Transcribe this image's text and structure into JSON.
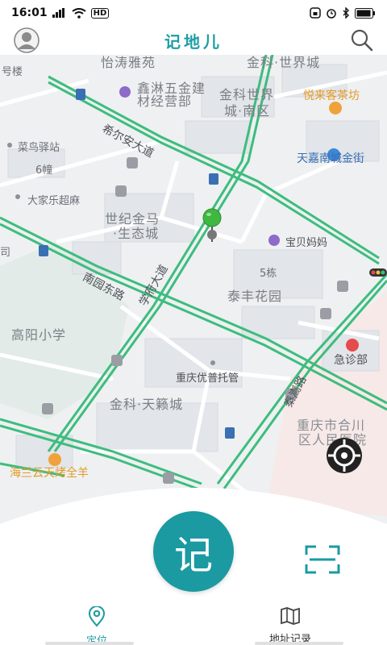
{
  "status_bar": {
    "time": "16:01",
    "network": "HD"
  },
  "header": {
    "title": "记地儿"
  },
  "map": {
    "labels": {
      "l1": "怡涛雅苑",
      "l2": "金科·世界城",
      "l3": "号楼",
      "l4": "鑫淋五金建",
      "l5": "材经营部",
      "l6": "金科世界",
      "l7": "城·南区",
      "l8": "悦来客茶坊",
      "l9": "希尔安大道",
      "l10": "菜鸟驿站",
      "l11": "6幢",
      "l12": "天嘉南城金街",
      "l13": "大家乐超麻",
      "l14": "世纪金马",
      "l15": "·生态城",
      "l16": "宝贝妈妈",
      "l17": "司",
      "l18": "5栋",
      "l19": "南园东路",
      "l20": "泰丰花园",
      "l21": "学府大道",
      "l22": "高阳小学",
      "l23": "急诊部",
      "l24": "重庆优普托管",
      "l25": "秦嵩路",
      "l26": "金科·天籁城",
      "l27": "重庆市合川",
      "l28": "区人民医院",
      "l29": "海兰云天烤全羊"
    }
  },
  "bottom": {
    "record_label": "记"
  },
  "tabs": {
    "locate": "定位",
    "records": "地址记录"
  },
  "colors": {
    "accent": "#1b9aa1",
    "road_green": "#3dbd7d",
    "map_bg": "#eef0f2"
  }
}
